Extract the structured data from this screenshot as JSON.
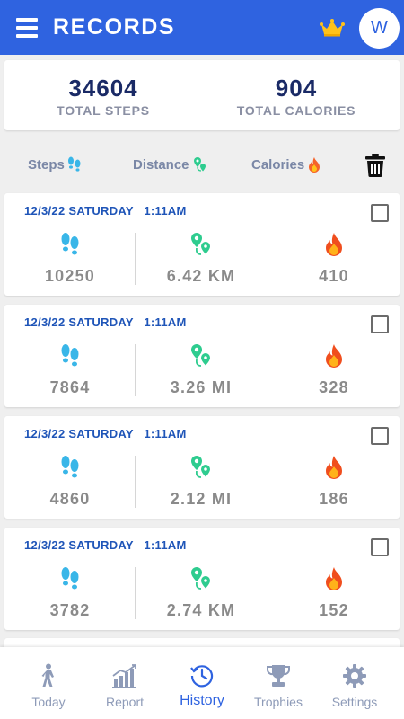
{
  "header": {
    "title": "RECORDS",
    "avatar_letter": "W",
    "color": "#2f63e0"
  },
  "summary": {
    "total_steps_value": "34604",
    "total_steps_label": "TOTAL STEPS",
    "total_calories_value": "904",
    "total_calories_label": "TOTAL CALORIES"
  },
  "sort": {
    "steps_label": "Steps",
    "distance_label": "Distance",
    "calories_label": "Calories"
  },
  "records": [
    {
      "date": "12/3/22 SATURDAY   1:11AM",
      "steps": "10250",
      "distance": "6.42 KM",
      "calories": "410",
      "checked": false
    },
    {
      "date": "12/3/22 SATURDAY   1:11AM",
      "steps": "7864",
      "distance": "3.26 MI",
      "calories": "328",
      "checked": false
    },
    {
      "date": "12/3/22 SATURDAY   1:11AM",
      "steps": "4860",
      "distance": "2.12 MI",
      "calories": "186",
      "checked": false
    },
    {
      "date": "12/3/22 SATURDAY   1:11AM",
      "steps": "3782",
      "distance": "2.74 KM",
      "calories": "152",
      "checked": false
    }
  ],
  "nav": {
    "items": [
      {
        "label": "Today",
        "icon": "walking-person-icon"
      },
      {
        "label": "Report",
        "icon": "bar-chart-icon"
      },
      {
        "label": "History",
        "icon": "clock-history-icon",
        "active": true
      },
      {
        "label": "Trophies",
        "icon": "trophy-icon"
      },
      {
        "label": "Settings",
        "icon": "gear-icon"
      }
    ]
  },
  "colors": {
    "steps_icon": "#39b6e8",
    "distance_icon": "#2ecc8f",
    "calories_icon": "#f04e1e",
    "nav_inactive": "#8e9bb8",
    "nav_active": "#2f63e0"
  }
}
